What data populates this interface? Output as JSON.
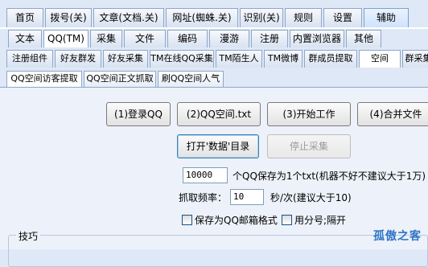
{
  "tabs_row1": [
    {
      "label": "首页",
      "active": false
    },
    {
      "label": "拨号(关)",
      "active": false
    },
    {
      "label": "文章(文档.关)",
      "active": false
    },
    {
      "label": "网址(蜘蛛.关)",
      "active": false
    },
    {
      "label": "识别(关)",
      "active": false
    },
    {
      "label": "规则",
      "active": false
    },
    {
      "label": "设置",
      "active": false
    },
    {
      "label": "辅助",
      "active": true
    }
  ],
  "tabs_row2": [
    {
      "label": "文本",
      "active": false
    },
    {
      "label": "QQ(TM)",
      "active": true
    },
    {
      "label": "采集",
      "active": false
    },
    {
      "label": "文件",
      "active": false
    },
    {
      "label": "编码",
      "active": false
    },
    {
      "label": "漫游",
      "active": false
    },
    {
      "label": "注册",
      "active": false
    },
    {
      "label": "内置浏览器",
      "active": false
    },
    {
      "label": "其他",
      "active": false
    }
  ],
  "tabs_row3": [
    {
      "label": "注册组件",
      "active": false
    },
    {
      "label": "好友群发",
      "active": false
    },
    {
      "label": "好友采集",
      "active": false
    },
    {
      "label": "TM在线QQ采集",
      "active": false
    },
    {
      "label": "TM陌生人",
      "active": false
    },
    {
      "label": "TM微博",
      "active": false
    },
    {
      "label": "群成员提取",
      "active": false
    },
    {
      "label": "空间",
      "active": true
    },
    {
      "label": "群采集",
      "active": false
    }
  ],
  "tabs_row4": [
    {
      "label": "QQ空间访客提取",
      "active": true
    },
    {
      "label": "QQ空间正文抓取",
      "active": false
    },
    {
      "label": "刷QQ空间人气",
      "active": false
    }
  ],
  "buttons": {
    "login": "(1)登录QQ",
    "qzone_txt": "(2)QQ空间.txt",
    "start": "(3)开始工作",
    "merge": "(4)合并文件",
    "open_dir": "打开'数据'目录",
    "stop": "停止采集"
  },
  "fields": {
    "per_txt_value": "10000",
    "per_txt_label": "个QQ保存为1个txt(机器不好不建议大于1万)",
    "freq_label": "抓取频率：",
    "freq_value": "10",
    "freq_unit": "秒/次(建议大于10)"
  },
  "options": {
    "save_as_email": "保存为QQ邮箱格式",
    "use_separator": "用分号;隔开"
  },
  "tips_title": "技巧",
  "watermark": "孤傲之客"
}
